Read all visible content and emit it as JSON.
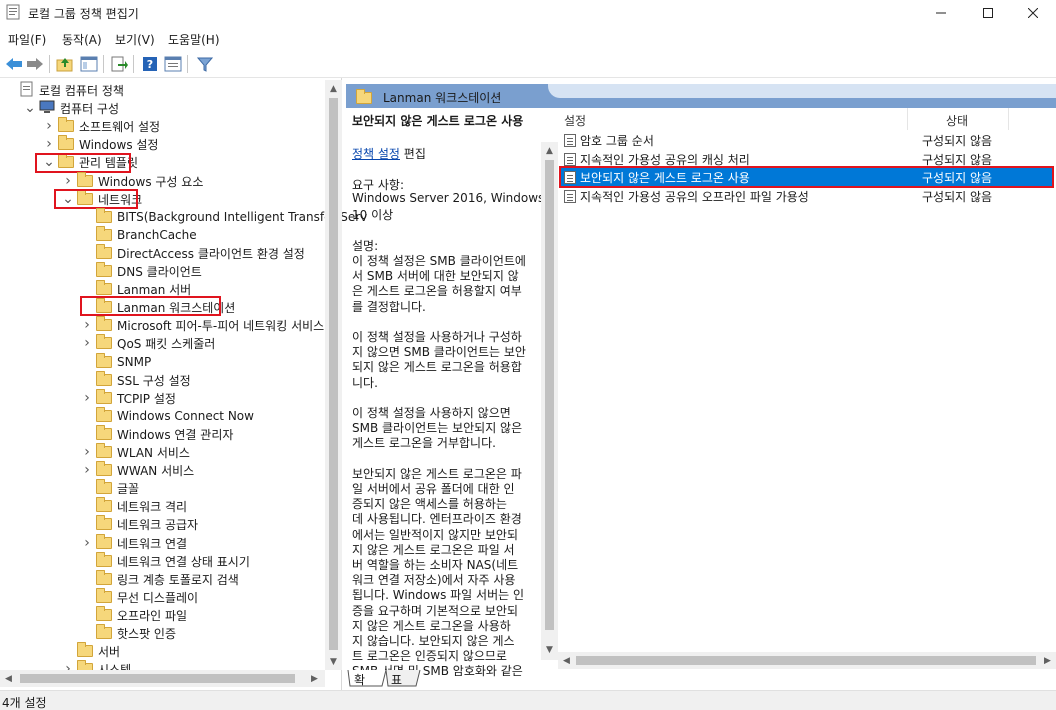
{
  "window": {
    "title": "로컬 그룹 정책 편집기"
  },
  "menu": [
    "파일(F)",
    "동작(A)",
    "보기(V)",
    "도움말(H)"
  ],
  "tree": [
    {
      "label": "로컬 컴퓨터 정책",
      "indent": 0,
      "arrow": "",
      "icon": "doc"
    },
    {
      "label": "컴퓨터 구성",
      "indent": 1,
      "arrow": "open",
      "icon": "pc"
    },
    {
      "label": "소프트웨어 설정",
      "indent": 2,
      "arrow": "closed",
      "icon": "folder"
    },
    {
      "label": "Windows 설정",
      "indent": 2,
      "arrow": "closed",
      "icon": "folder"
    },
    {
      "label": "관리 템플릿",
      "indent": 2,
      "arrow": "open",
      "icon": "folder"
    },
    {
      "label": "Windows 구성 요소",
      "indent": 3,
      "arrow": "closed",
      "icon": "folder"
    },
    {
      "label": "네트워크",
      "indent": 3,
      "arrow": "open",
      "icon": "folder"
    },
    {
      "label": "BITS(Background Intelligent Transfer Serv",
      "indent": 4,
      "arrow": "",
      "icon": "folder"
    },
    {
      "label": "BranchCache",
      "indent": 4,
      "arrow": "",
      "icon": "folder"
    },
    {
      "label": "DirectAccess 클라이언트 환경 설정",
      "indent": 4,
      "arrow": "",
      "icon": "folder"
    },
    {
      "label": "DNS 클라이언트",
      "indent": 4,
      "arrow": "",
      "icon": "folder"
    },
    {
      "label": "Lanman 서버",
      "indent": 4,
      "arrow": "",
      "icon": "folder"
    },
    {
      "label": "Lanman 워크스테이션",
      "indent": 4,
      "arrow": "",
      "icon": "folder"
    },
    {
      "label": "Microsoft 피어-투-피어 네트워킹 서비스",
      "indent": 4,
      "arrow": "closed",
      "icon": "folder"
    },
    {
      "label": "QoS 패킷 스케줄러",
      "indent": 4,
      "arrow": "closed",
      "icon": "folder"
    },
    {
      "label": "SNMP",
      "indent": 4,
      "arrow": "",
      "icon": "folder"
    },
    {
      "label": "SSL 구성 설정",
      "indent": 4,
      "arrow": "",
      "icon": "folder"
    },
    {
      "label": "TCPIP 설정",
      "indent": 4,
      "arrow": "closed",
      "icon": "folder"
    },
    {
      "label": "Windows Connect Now",
      "indent": 4,
      "arrow": "",
      "icon": "folder"
    },
    {
      "label": "Windows 연결 관리자",
      "indent": 4,
      "arrow": "",
      "icon": "folder"
    },
    {
      "label": "WLAN 서비스",
      "indent": 4,
      "arrow": "closed",
      "icon": "folder"
    },
    {
      "label": "WWAN 서비스",
      "indent": 4,
      "arrow": "closed",
      "icon": "folder"
    },
    {
      "label": "글꼴",
      "indent": 4,
      "arrow": "",
      "icon": "folder"
    },
    {
      "label": "네트워크 격리",
      "indent": 4,
      "arrow": "",
      "icon": "folder"
    },
    {
      "label": "네트워크 공급자",
      "indent": 4,
      "arrow": "",
      "icon": "folder"
    },
    {
      "label": "네트워크 연결",
      "indent": 4,
      "arrow": "closed",
      "icon": "folder"
    },
    {
      "label": "네트워크 연결 상태 표시기",
      "indent": 4,
      "arrow": "",
      "icon": "folder"
    },
    {
      "label": "링크 계층 토폴로지 검색",
      "indent": 4,
      "arrow": "",
      "icon": "folder"
    },
    {
      "label": "무선 디스플레이",
      "indent": 4,
      "arrow": "",
      "icon": "folder"
    },
    {
      "label": "오프라인 파일",
      "indent": 4,
      "arrow": "",
      "icon": "folder"
    },
    {
      "label": "핫스팟 인증",
      "indent": 4,
      "arrow": "",
      "icon": "folder"
    },
    {
      "label": "서버",
      "indent": 3,
      "arrow": "",
      "icon": "folder"
    },
    {
      "label": "시스템",
      "indent": 3,
      "arrow": "closed",
      "icon": "folder"
    }
  ],
  "middle": {
    "header": "Lanman 워크스테이션",
    "policy_title": "보안되지 않은 게스트 로그온 사용",
    "edit_link": "정책 설정",
    "edit_suffix": " 편집",
    "desc_lines": [
      "요구 사항:",
      "Windows Server 2016, Windows",
      "10 이상",
      "",
      "설명:",
      "이 정책 설정은 SMB 클라이언트에",
      "서 SMB 서버에 대한 보안되지 않",
      "은 게스트 로그온을 허용할지 여부",
      "를 결정합니다.",
      "",
      "이 정책 설정을 사용하거나 구성하",
      "지 않으면 SMB 클라이언트는 보안",
      "되지 않은 게스트 로그온을 허용합",
      "니다.",
      "",
      "이 정책 설정을 사용하지 않으면",
      "SMB 클라이언트는 보안되지 않은",
      "게스트 로그온을 거부합니다.",
      "",
      "보안되지 않은 게스트 로그온은 파",
      "일 서버에서 공유 폴더에 대한 인",
      "증되지 않은 액세스를 허용하는",
      "데 사용됩니다. 엔터프라이즈 환경",
      "에서는 일반적이지 않지만 보안되",
      "지 않은 게스트 로그온은 파일 서",
      "버 역할을 하는 소비자 NAS(네트",
      "워크 연결 저장소)에서 자주 사용",
      "됩니다. Windows 파일 서버는 인",
      "증을 요구하며 기본적으로 보안되",
      "지 않은 게스트 로그온을 사용하",
      "지 않습니다. 보안되지 않은 게스",
      "트 로그온은 인증되지 않으므로",
      "SMB 서명 및 SMB 암호화와 같은"
    ]
  },
  "list": {
    "col_setting": "설정",
    "col_state": "상태",
    "rows": [
      {
        "name": "암호 그룹 순서",
        "state": "구성되지 않음",
        "selected": false
      },
      {
        "name": "지속적인 가용성 공유의 캐싱 처리",
        "state": "구성되지 않음",
        "selected": false
      },
      {
        "name": "보안되지 않은 게스트 로그온 사용",
        "state": "구성되지 않음",
        "selected": true
      },
      {
        "name": "지속적인 가용성 공유의 오프라인 파일 가용성",
        "state": "구성되지 않음",
        "selected": false
      }
    ]
  },
  "tabs": [
    "확장",
    "표준"
  ],
  "status": "4개 설정",
  "colors": {
    "selection": "#0078d7",
    "highlight_box": "#e0141e",
    "header_band": "#7a9fcf"
  }
}
